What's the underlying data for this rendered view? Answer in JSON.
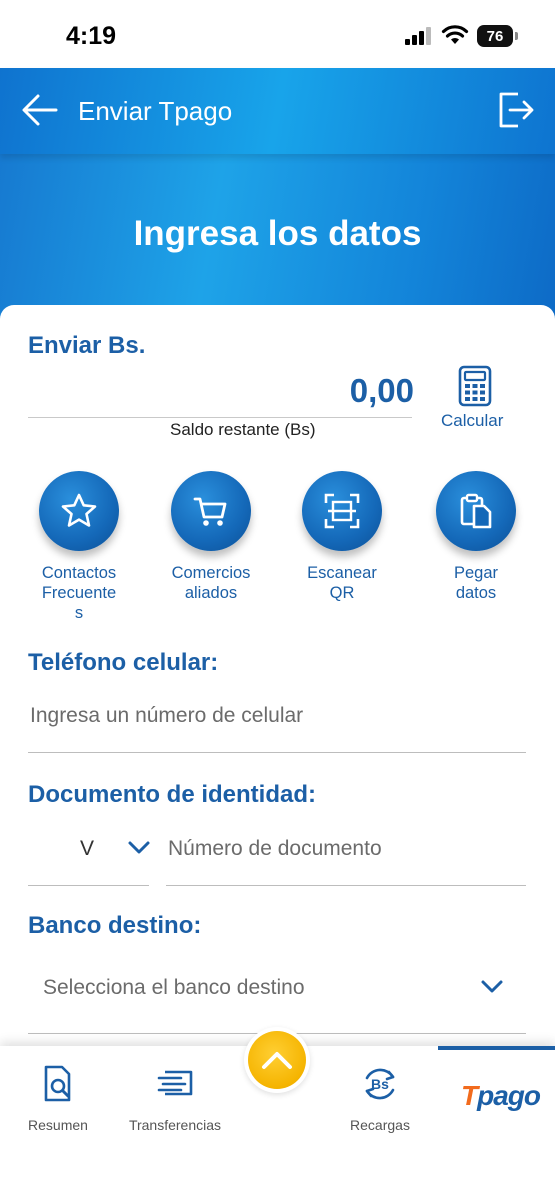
{
  "status_bar": {
    "time": "4:19",
    "battery": "76"
  },
  "header": {
    "title": "Enviar Tpago",
    "heading": "Ingresa los datos"
  },
  "amount_section": {
    "label": "Enviar Bs.",
    "amount": "0,00",
    "saldo_label": "Saldo restante (Bs)",
    "calc_label": "Calcular"
  },
  "actions": [
    {
      "label": "Contactos Frecuente s",
      "icon": "star-icon"
    },
    {
      "label": "Comercios aliados",
      "icon": "cart-icon"
    },
    {
      "label": "Escanear QR",
      "icon": "qr-scan-icon"
    },
    {
      "label": "Pegar datos",
      "icon": "paste-icon"
    }
  ],
  "phone": {
    "label": "Teléfono celular:",
    "placeholder": "Ingresa un número de celular"
  },
  "document": {
    "label": "Documento de identidad:",
    "type": "V",
    "placeholder": "Número de documento"
  },
  "bank": {
    "label": "Banco destino:",
    "placeholder": "Selecciona el banco destino"
  },
  "bottom_nav": {
    "items": [
      {
        "label": "Resumen",
        "icon": "summary-search-icon"
      },
      {
        "label": "Transferencias",
        "icon": "transfer-icon"
      },
      {
        "label": "Recargas",
        "icon": "bs-recharge-icon"
      }
    ],
    "brand": {
      "t": "T",
      "rest": "pago"
    }
  },
  "colors": {
    "primary": "#1c5fa6",
    "accent": "#f5b400",
    "brand_orange": "#f26b1d"
  }
}
